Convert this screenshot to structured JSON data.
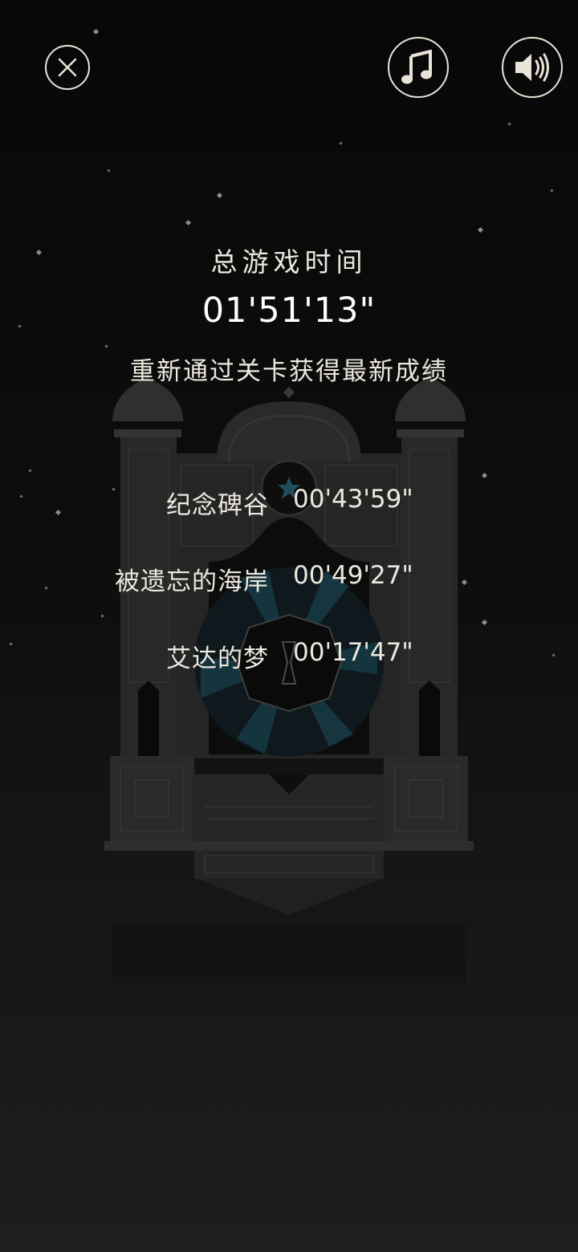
{
  "buttons": {
    "close_icon": "close-icon",
    "music_icon": "music-note-icon",
    "sound_icon": "speaker-icon"
  },
  "stats": {
    "total_label": "总游戏时间",
    "total_time": "01'51'13\"",
    "replay_note": "重新通过关卡获得最新成绩"
  },
  "levels": [
    {
      "name": "纪念碑谷",
      "time": "00'43'59\""
    },
    {
      "name": "被遗忘的海岸",
      "time": "00'49'27\""
    },
    {
      "name": "艾达的梦",
      "time": "00'17'47\""
    }
  ],
  "colors": {
    "background": "#0b0b0b",
    "text": "#ece8de",
    "monument": "#2c2c2c",
    "accent_teal": "#1f4e5a"
  }
}
